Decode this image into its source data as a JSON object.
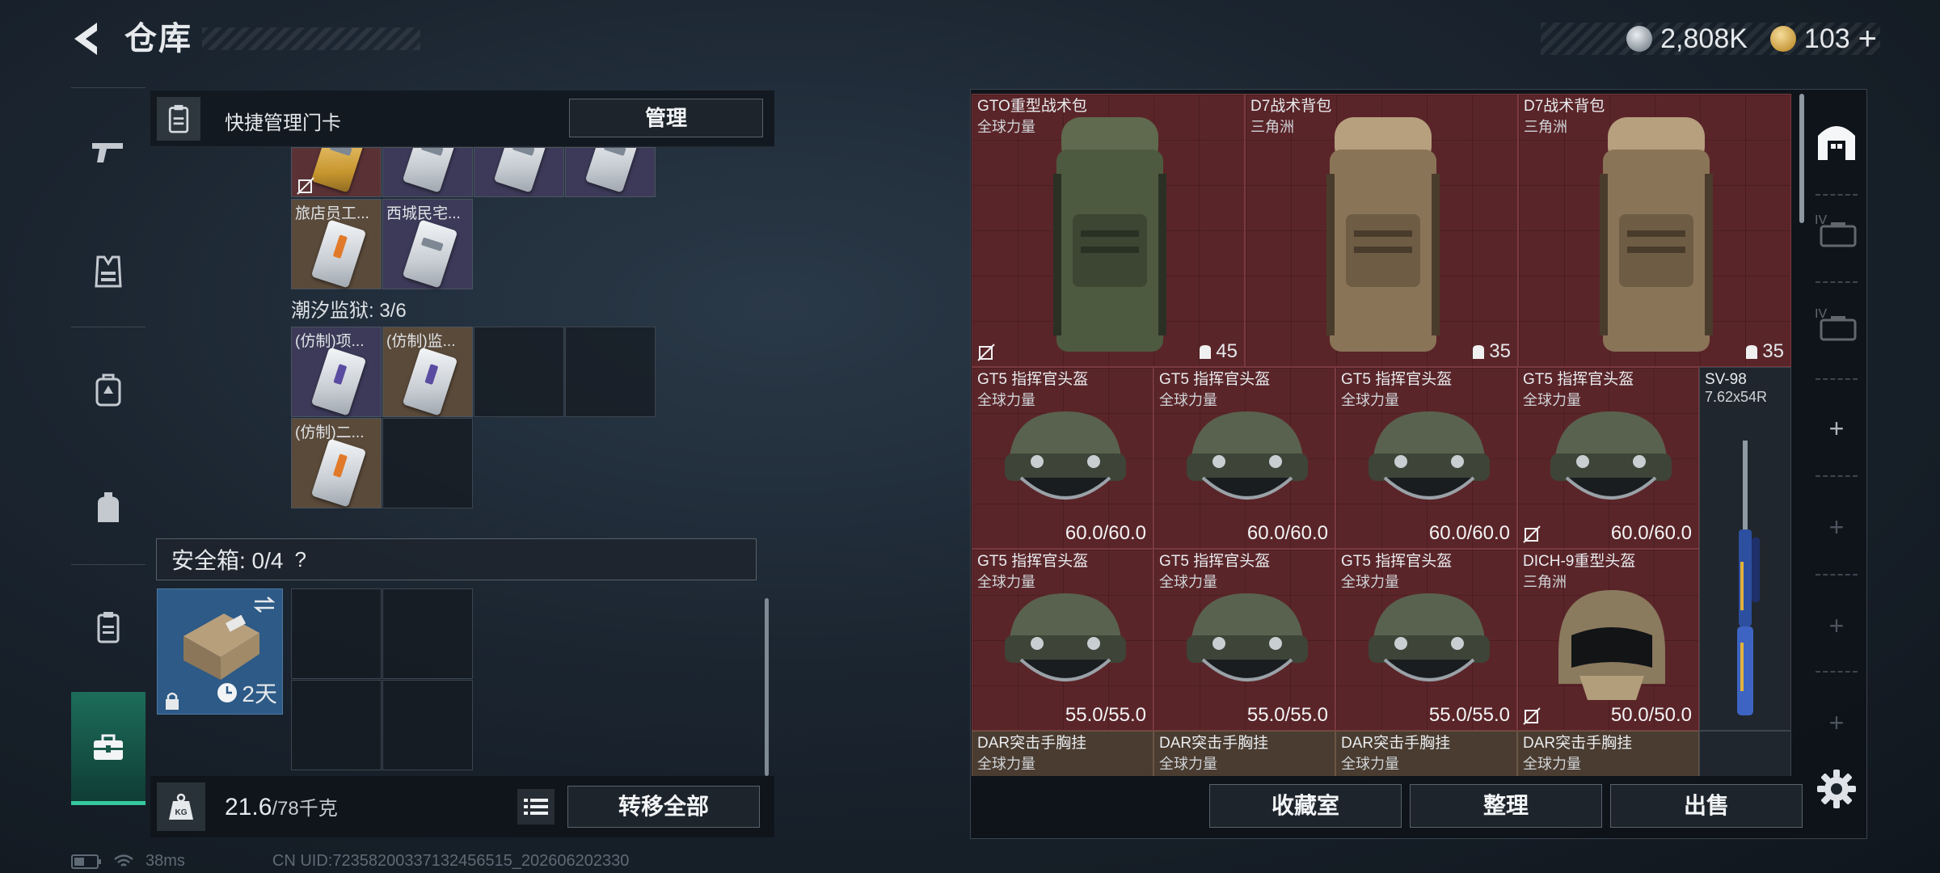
{
  "header": {
    "title": "仓库",
    "currency_silver": "2,808K",
    "currency_gold": "103",
    "plus_symbol": "+"
  },
  "left_nav": {
    "items": [
      "weapons",
      "armor",
      "backpack",
      "bag",
      "keycard",
      "safebox"
    ],
    "active": "safebox"
  },
  "keycards": {
    "header_label": "快捷管理门卡",
    "manage_button": "管理",
    "partial_row": [
      {
        "label": "",
        "type": "gold"
      },
      {
        "label": "",
        "type": "white"
      },
      {
        "label": "",
        "type": "white"
      },
      {
        "label": "",
        "type": "white"
      }
    ],
    "row2": [
      {
        "label": "旅店员工...",
        "type": "orange"
      },
      {
        "label": "西城民宅...",
        "type": "white"
      }
    ],
    "section_title": "潮汐监狱: 3/6",
    "section_items": [
      {
        "label": "(仿制)项...",
        "type": "purple"
      },
      {
        "label": "(仿制)监...",
        "type": "purple"
      },
      {
        "label": "(仿制)二...",
        "type": "orange"
      }
    ]
  },
  "safebox": {
    "label": "安全箱: 0/4",
    "help": "?",
    "timer": "2天"
  },
  "bottom_bar": {
    "weight_current": "21.6",
    "weight_max": "/78千克",
    "transfer_all": "转移全部"
  },
  "status": {
    "ping": "38ms",
    "uid": "CN UID:72358200337132456515_202606202330"
  },
  "stash": {
    "backpacks": [
      {
        "name": "GTO重型战术包",
        "sub": "全球力量",
        "capacity": "45"
      },
      {
        "name": "D7战术背包",
        "sub": "三角洲",
        "capacity": "35"
      },
      {
        "name": "D7战术背包",
        "sub": "三角洲",
        "capacity": "35"
      }
    ],
    "helmets_row1": [
      {
        "name": "GT5 指挥官头盔",
        "sub": "全球力量",
        "durability": "60.0/60.0"
      },
      {
        "name": "GT5 指挥官头盔",
        "sub": "全球力量",
        "durability": "60.0/60.0"
      },
      {
        "name": "GT5 指挥官头盔",
        "sub": "全球力量",
        "durability": "60.0/60.0"
      },
      {
        "name": "GT5 指挥官头盔",
        "sub": "全球力量",
        "durability": "60.0/60.0"
      }
    ],
    "helmets_row2": [
      {
        "name": "GT5 指挥官头盔",
        "sub": "全球力量",
        "durability": "55.0/55.0"
      },
      {
        "name": "GT5 指挥官头盔",
        "sub": "全球力量",
        "durability": "55.0/55.0"
      },
      {
        "name": "GT5 指挥官头盔",
        "sub": "全球力量",
        "durability": "55.0/55.0"
      },
      {
        "name": "DICH-9重型头盔",
        "sub": "三角洲",
        "durability": "50.0/50.0"
      }
    ],
    "rig_row": [
      {
        "name": "DAR突击手胸挂",
        "sub": "全球力量"
      },
      {
        "name": "DAR突击手胸挂",
        "sub": "全球力量"
      },
      {
        "name": "DAR突击手胸挂",
        "sub": "全球力量"
      },
      {
        "name": "DAR突击手胸挂",
        "sub": "全球力量"
      }
    ],
    "rifle": {
      "name": "SV-98",
      "caliber": "7.62x54R"
    }
  },
  "right_buttons": {
    "collection": "收藏室",
    "sort": "整理",
    "sell": "出售"
  },
  "right_tabs": {
    "tier_label": "IV",
    "add_symbol": "+"
  }
}
